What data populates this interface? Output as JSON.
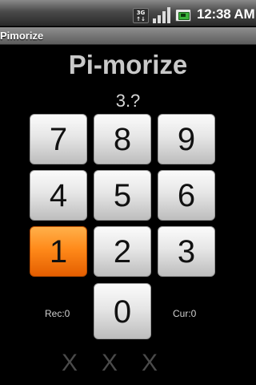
{
  "status_bar": {
    "network_label": "3G",
    "time": "12:38",
    "ampm": "AM",
    "icons": [
      "3g-icon",
      "signal-icon",
      "battery-icon"
    ]
  },
  "title_bar": {
    "title": "Pimorize"
  },
  "main": {
    "heading": "Pi-morize",
    "digits": "3.?",
    "keypad": [
      "7",
      "8",
      "9",
      "4",
      "5",
      "6",
      "1",
      "2",
      "3",
      "0"
    ],
    "highlighted_key": "1",
    "record_label": "Rec:0",
    "current_label": "Cur:0",
    "attempts": [
      "X",
      "X",
      "X"
    ]
  },
  "colors": {
    "background": "#000000",
    "key_normal": "#e6e6e6",
    "key_highlight": "#ff8a1a",
    "heading": "#c9c9c9",
    "attempt_mark": "#4a4a4a"
  }
}
